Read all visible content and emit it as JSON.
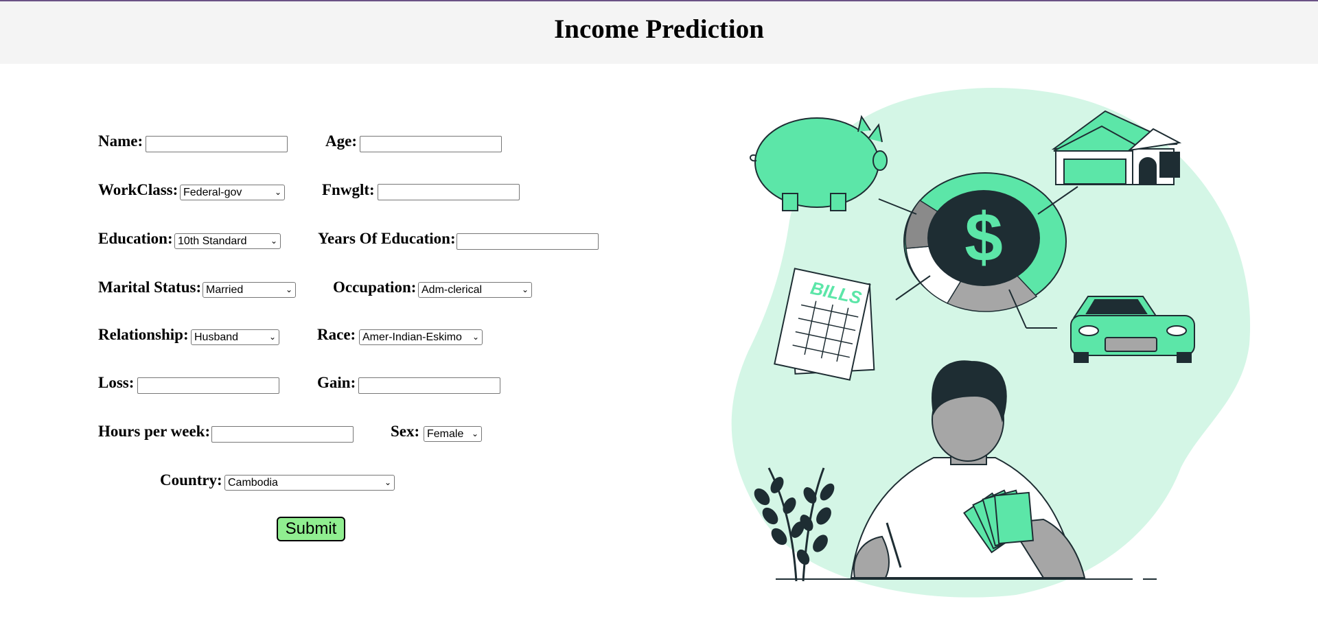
{
  "header": {
    "title": "Income Prediction"
  },
  "form": {
    "name": {
      "label": "Name:",
      "value": ""
    },
    "age": {
      "label": "Age:",
      "value": ""
    },
    "workclass": {
      "label": "WorkClass:",
      "selected": "Federal-gov"
    },
    "fnwglt": {
      "label": "Fnwglt:",
      "value": ""
    },
    "education": {
      "label": "Education:",
      "selected": "10th Standard"
    },
    "years_of_education": {
      "label": "Years Of Education:",
      "value": ""
    },
    "marital_status": {
      "label": "Marital Status:",
      "selected": "Married"
    },
    "occupation": {
      "label": "Occupation:",
      "selected": "Adm-clerical"
    },
    "relationship": {
      "label": "Relationship:",
      "selected": "Husband"
    },
    "race": {
      "label": "Race:",
      "selected": "Amer-Indian-Eskimo"
    },
    "loss": {
      "label": "Loss:",
      "value": ""
    },
    "gain": {
      "label": "Gain:",
      "value": ""
    },
    "hours_per_week": {
      "label": "Hours per week:",
      "value": ""
    },
    "sex": {
      "label": "Sex:",
      "selected": "Female"
    },
    "country": {
      "label": "Country:",
      "selected": "Cambodia"
    },
    "submit_label": "Submit"
  },
  "illustration": {
    "bills_text": "BILLS",
    "currency_symbol": "$",
    "colors": {
      "green": "#5ce6a8",
      "mint_blob": "#d4f6e6",
      "dark": "#1e2d33",
      "gray": "#a6a6a6"
    }
  }
}
